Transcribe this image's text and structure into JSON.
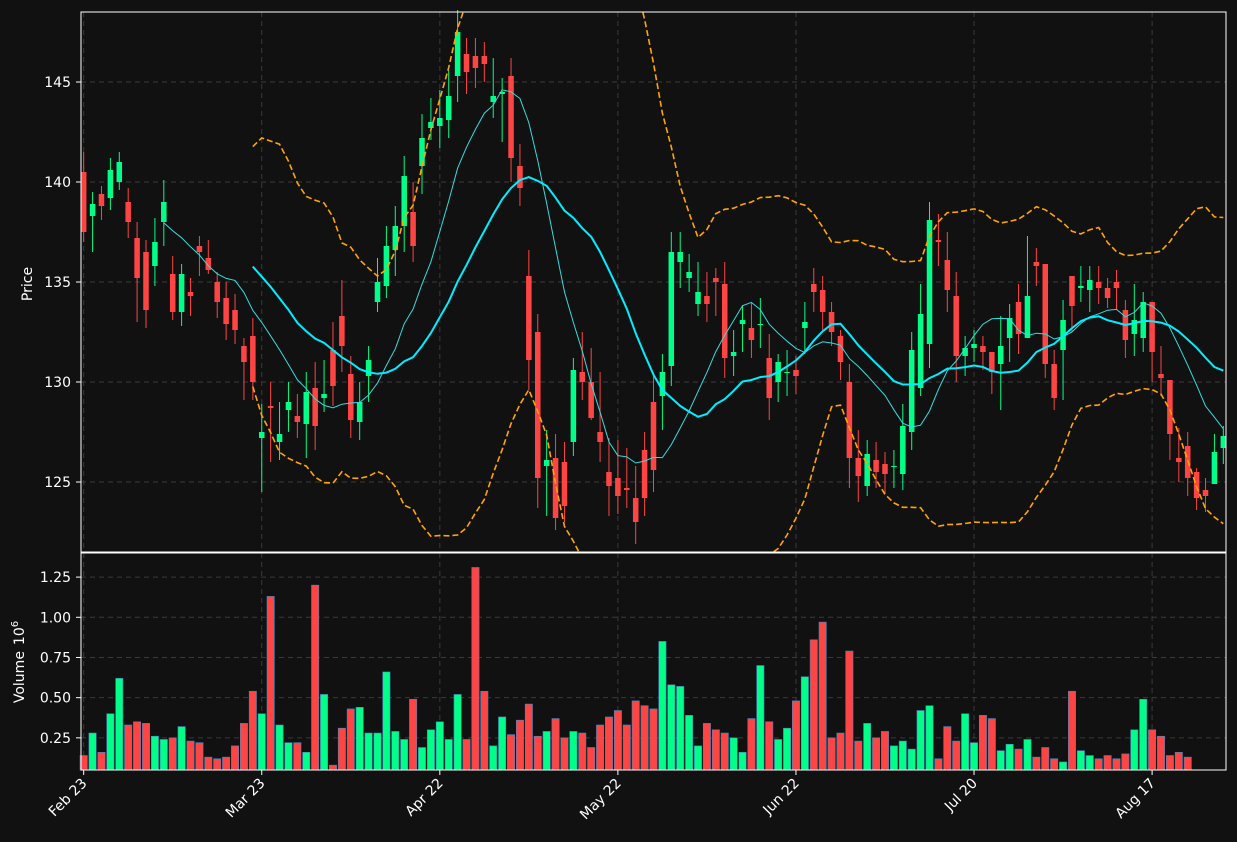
{
  "chart_data": {
    "type": "candlestick",
    "ylabel_price": "Price",
    "ylabel_volume": "Volume",
    "volume_exponent_label": "10",
    "volume_exponent_power": "6",
    "x_tick_labels": [
      "Feb 23",
      "Mar 23",
      "Apr 22",
      "May 22",
      "Jun 22",
      "Jul 20",
      "Aug 17"
    ],
    "x_tick_indices": [
      0,
      20,
      40,
      60,
      80,
      100,
      120
    ],
    "price_ylim": [
      121.5,
      148.5
    ],
    "price_ticks": [
      125,
      130,
      135,
      140,
      145
    ],
    "price_tick_labels": [
      "125",
      "130",
      "135",
      "140",
      "145"
    ],
    "volume_ylim": [
      0.05,
      1.4
    ],
    "volume_ticks": [
      0.25,
      0.5,
      0.75,
      1.0,
      1.25
    ],
    "volume_tick_labels": [
      "0.25",
      "0.50",
      "0.75",
      "1.00",
      "1.25"
    ],
    "grid": true,
    "colors": {
      "background": "#111111",
      "up": "#00ff88",
      "down": "#ff4444",
      "volume_edge": "#4488bb",
      "grid": "#3a3a3a",
      "axis": "#ffffff",
      "ma_fast": "#33dddd",
      "ma_slow": "#00eeff",
      "bollinger": "#ffa500"
    },
    "close": [
      137.5,
      138.9,
      138.8,
      140.6,
      141.0,
      138.0,
      135.2,
      133.6,
      137.0,
      139.0,
      133.5,
      135.4,
      134.3,
      136.5,
      135.6,
      134.0,
      132.9,
      132.6,
      131.0,
      130.0,
      127.5,
      128.7,
      127.4,
      129.0,
      128.0,
      129.5,
      127.8,
      129.4,
      129.8,
      131.8,
      128.1,
      129.0,
      131.1,
      135.0,
      136.8,
      137.8,
      140.3,
      136.8,
      142.2,
      143.0,
      143.2,
      144.3,
      147.5,
      145.5,
      145.7,
      145.9,
      144.3,
      144.5,
      141.2,
      139.7,
      131.1,
      125.2,
      126.1,
      123.2,
      123.8,
      130.6,
      130.0,
      128.2,
      127.0,
      124.8,
      124.3,
      124.6,
      123.0,
      124.2,
      125.6,
      130.5,
      136.5,
      136.5,
      135.5,
      134.5,
      133.9,
      135.0,
      131.2,
      131.5,
      133.1,
      132.1,
      132.9,
      129.2,
      131.0,
      130.5,
      130.3,
      133.0,
      134.5,
      133.5,
      132.5,
      131.0,
      126.2,
      125.3,
      126.4,
      125.5,
      125.4,
      125.8,
      127.8,
      131.6,
      133.4,
      138.1,
      137.0,
      134.6,
      131.3,
      131.7,
      131.9,
      131.5,
      130.5,
      131.8,
      133.2,
      132.4,
      134.3,
      135.8,
      130.9,
      129.2,
      133.1,
      133.8,
      134.8,
      135.1,
      134.7,
      134.2,
      134.7,
      132.1,
      133.1,
      134.0,
      131.5,
      130.2,
      127.4,
      126.0,
      125.2,
      124.2,
      124.3,
      126.5,
      127.3
    ],
    "open": [
      140.5,
      138.3,
      139.4,
      139.2,
      140.0,
      139.0,
      137.2,
      136.5,
      135.8,
      138.0,
      135.4,
      133.5,
      134.5,
      136.8,
      136.2,
      135.0,
      134.2,
      133.6,
      131.8,
      132.3,
      127.2,
      128.8,
      127.0,
      128.6,
      128.3,
      127.9,
      129.7,
      129.2,
      131.6,
      133.3,
      130.4,
      128.0,
      130.3,
      134.0,
      134.8,
      136.6,
      137.8,
      138.5,
      140.8,
      142.7,
      142.8,
      143.1,
      145.3,
      146.4,
      146.3,
      146.3,
      144.0,
      144.4,
      145.3,
      140.8,
      135.3,
      132.5,
      125.8,
      126.2,
      126.0,
      127.0,
      130.5,
      130.0,
      127.5,
      125.5,
      125.2,
      124.7,
      124.2,
      126.6,
      129.0,
      129.3,
      130.8,
      136.0,
      135.2,
      133.9,
      134.3,
      135.2,
      134.9,
      131.3,
      132.9,
      132.7,
      132.9,
      131.2,
      130.0,
      130.5,
      130.6,
      132.7,
      134.9,
      134.6,
      133.5,
      132.3,
      130.0,
      126.2,
      124.8,
      126.1,
      125.9,
      125.8,
      125.4,
      127.5,
      129.7,
      131.9,
      137.1,
      136.1,
      134.3,
      131.3,
      131.7,
      131.8,
      131.5,
      130.9,
      132.2,
      134.0,
      132.2,
      136.0,
      135.9,
      130.9,
      131.6,
      135.3,
      134.7,
      134.6,
      135.0,
      134.7,
      135.0,
      133.6,
      132.4,
      132.2,
      134.0,
      130.4,
      130.1,
      126.2,
      126.8,
      125.5,
      124.6,
      124.9,
      126.7
    ],
    "high": [
      141.5,
      139.5,
      139.8,
      141.2,
      141.5,
      139.7,
      138.0,
      137.1,
      138.2,
      140.1,
      136.3,
      135.9,
      135.2,
      137.3,
      137.1,
      135.5,
      135.0,
      134.4,
      132.2,
      133.2,
      128.9,
      130.0,
      129.0,
      130.0,
      129.4,
      130.5,
      131.0,
      131.1,
      133.0,
      135.1,
      131.3,
      130.0,
      131.8,
      136.2,
      137.8,
      138.8,
      141.3,
      140.0,
      143.4,
      144.2,
      144.6,
      145.6,
      148.6,
      147.2,
      147.2,
      147.0,
      146.2,
      145.2,
      146.2,
      141.9,
      136.6,
      133.4,
      127.6,
      127.4,
      127.0,
      131.2,
      132.5,
      131.7,
      130.5,
      127.2,
      127.1,
      126.7,
      125.8,
      127.5,
      130.4,
      131.4,
      137.5,
      137.5,
      136.4,
      136.0,
      135.5,
      135.7,
      136.0,
      132.6,
      133.8,
      134.0,
      134.2,
      132.4,
      131.4,
      131.6,
      131.3,
      134.0,
      135.7,
      135.3,
      134.0,
      132.6,
      130.9,
      127.6,
      127.1,
      127.0,
      126.5,
      126.6,
      128.9,
      132.5,
      134.9,
      139.0,
      138.4,
      137.5,
      135.5,
      132.3,
      132.6,
      132.3,
      131.3,
      133.3,
      133.9,
      134.9,
      137.3,
      136.7,
      132.9,
      131.6,
      134.1,
      135.3,
      135.8,
      135.8,
      135.8,
      135.2,
      135.6,
      134.1,
      134.9,
      134.5,
      133.0,
      131.8,
      128.7,
      127.7,
      127.5,
      125.7,
      125.2,
      127.4,
      127.8
    ],
    "low": [
      137.0,
      136.5,
      138.1,
      138.6,
      139.6,
      137.2,
      133.0,
      132.7,
      134.8,
      136.8,
      133.1,
      132.8,
      133.3,
      135.3,
      135.4,
      133.2,
      132.1,
      131.9,
      129.1,
      129.1,
      124.5,
      126.0,
      126.1,
      127.5,
      127.2,
      126.2,
      126.6,
      128.5,
      128.8,
      130.5,
      127.2,
      127.1,
      129.0,
      133.5,
      134.2,
      135.3,
      136.5,
      136.0,
      139.4,
      142.1,
      141.7,
      142.2,
      144.0,
      144.4,
      144.7,
      145.0,
      143.2,
      142.0,
      140.0,
      138.8,
      129.6,
      123.7,
      123.3,
      122.6,
      123.0,
      126.3,
      129.1,
      128.1,
      126.0,
      123.3,
      123.4,
      123.7,
      121.9,
      123.3,
      124.5,
      127.6,
      129.8,
      134.7,
      134.5,
      133.3,
      133.0,
      133.3,
      130.2,
      130.3,
      131.5,
      131.2,
      131.7,
      128.1,
      129.0,
      129.3,
      129.4,
      131.4,
      133.5,
      132.6,
      131.8,
      130.1,
      124.7,
      124.0,
      124.3,
      124.7,
      124.4,
      124.7,
      124.6,
      126.6,
      129.3,
      130.7,
      135.8,
      133.5,
      130.0,
      130.3,
      131.0,
      130.6,
      129.4,
      128.6,
      131.0,
      131.4,
      133.6,
      134.8,
      130.2,
      128.6,
      129.1,
      132.5,
      134.0,
      133.5,
      133.9,
      133.7,
      133.6,
      131.2,
      131.3,
      131.5,
      130.0,
      129.3,
      126.1,
      125.0,
      124.3,
      123.6,
      123.5,
      125.0,
      125.9
    ],
    "volume": [
      0.14,
      0.28,
      0.16,
      0.4,
      0.62,
      0.33,
      0.35,
      0.34,
      0.26,
      0.24,
      0.25,
      0.32,
      0.23,
      0.22,
      0.13,
      0.12,
      0.13,
      0.2,
      0.34,
      0.54,
      0.4,
      1.13,
      0.33,
      0.22,
      0.22,
      0.16,
      1.2,
      0.52,
      0.08,
      0.31,
      0.43,
      0.44,
      0.28,
      0.28,
      0.66,
      0.29,
      0.24,
      0.49,
      0.19,
      0.3,
      0.35,
      0.24,
      0.52,
      0.24,
      1.31,
      0.54,
      0.2,
      0.38,
      0.27,
      0.36,
      0.46,
      0.26,
      0.29,
      0.37,
      0.25,
      0.29,
      0.28,
      0.19,
      0.33,
      0.38,
      0.42,
      0.33,
      0.48,
      0.45,
      0.43,
      0.85,
      0.58,
      0.57,
      0.39,
      0.2,
      0.34,
      0.3,
      0.28,
      0.25,
      0.16,
      0.37,
      0.7,
      0.35,
      0.24,
      0.31,
      0.48,
      0.63,
      0.86,
      0.97,
      0.25,
      0.28,
      0.79,
      0.23,
      0.34,
      0.25,
      0.29,
      0.2,
      0.23,
      0.18,
      0.42,
      0.45,
      0.12,
      0.32,
      0.23,
      0.4,
      0.22,
      0.39,
      0.37,
      0.17,
      0.21,
      0.18,
      0.24,
      0.13,
      0.19,
      0.12,
      0.1,
      0.54,
      0.17,
      0.14,
      0.12,
      0.14,
      0.12,
      0.15,
      0.3,
      0.49,
      0.3,
      0.26,
      0.14,
      0.16,
      0.13
    ]
  }
}
